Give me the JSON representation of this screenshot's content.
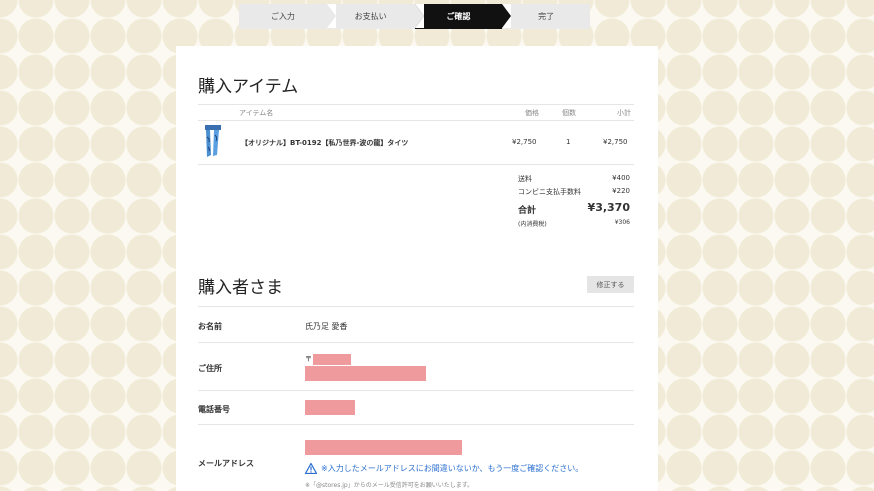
{
  "steps": [
    "ご入力",
    "お支払い",
    "ご確認",
    "完了"
  ],
  "items_section": {
    "title": "購入アイテム",
    "headers": {
      "name": "アイテム名",
      "price": "価格",
      "qty": "個数",
      "subtotal": "小計"
    },
    "item": {
      "name": "【オリジナル】BT-0192【私乃世界-波の龍】タイツ",
      "price": "¥2,750",
      "qty": "1",
      "subtotal": "¥2,750"
    }
  },
  "summary": {
    "shipping_label": "送料",
    "shipping": "¥400",
    "fee_label": "コンビニ支払手数料",
    "fee": "¥220",
    "total_label": "合計",
    "total": "¥3,370",
    "tax_label": "(内消費税)",
    "tax": "¥306"
  },
  "buyer_section": {
    "title": "購入者さま",
    "edit_label": "修正する",
    "name_label": "お名前",
    "name_value": "氏乃足 愛香",
    "address_label": "ご住所",
    "postal_prefix": "〒",
    "phone_label": "電話番号",
    "email_label": "メールアドレス",
    "email_warning": "※入力したメールアドレスにお間違いないか、もう一度ご確認ください。",
    "email_note": "※「@stores.jp」からのメール受信許可をお願いいたします。"
  },
  "colors": {
    "redaction": "#ef9a9c",
    "warning": "#2a6fd0",
    "active_step": "#111111"
  }
}
